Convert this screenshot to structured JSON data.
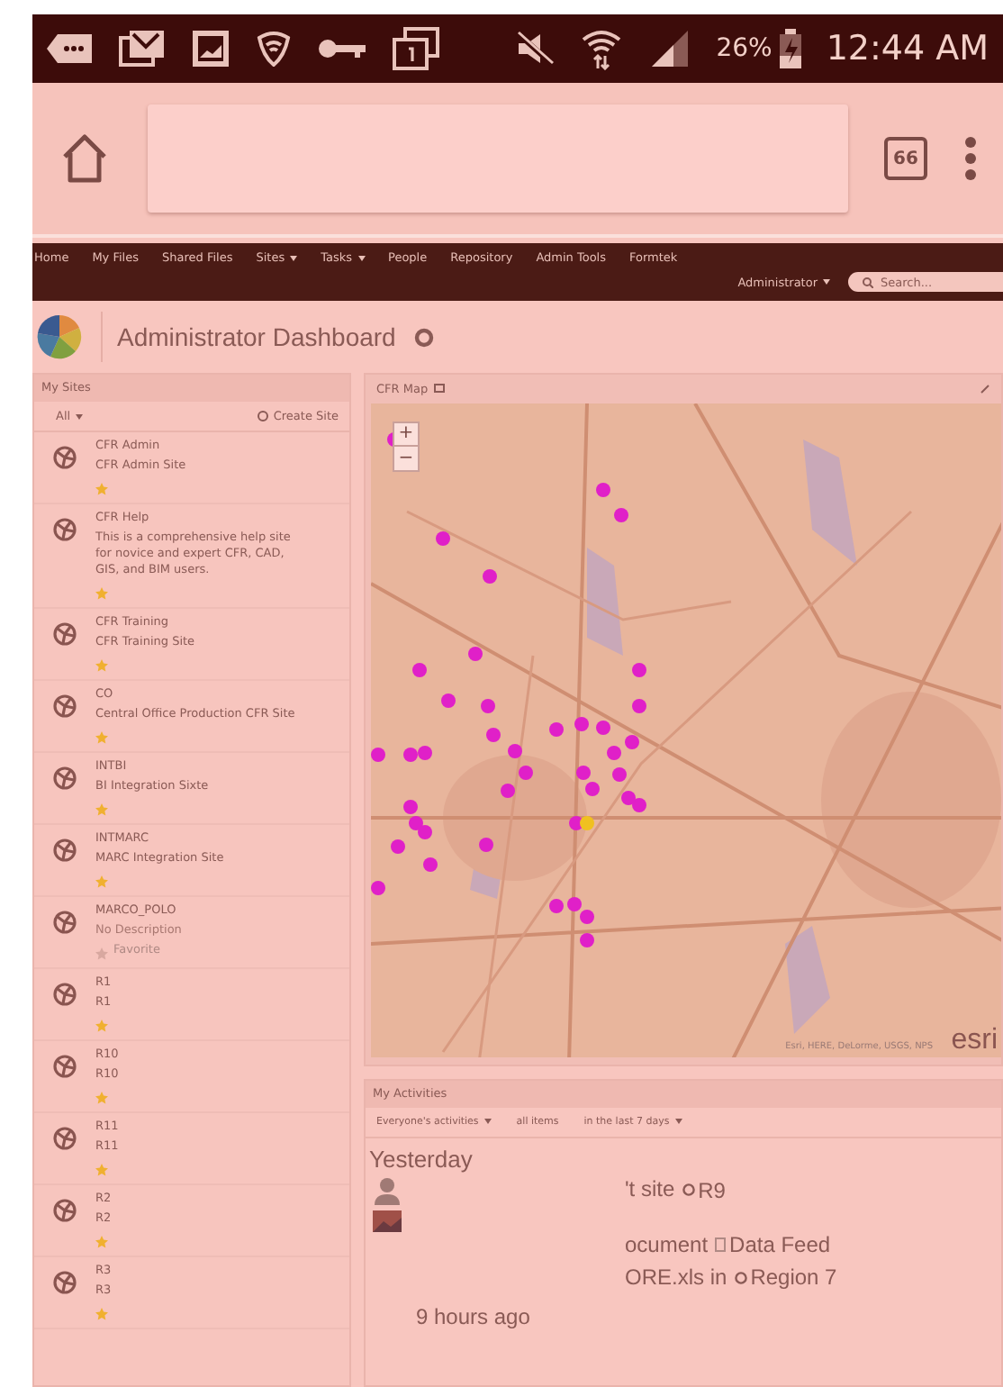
{
  "status_bar": {
    "battery": "26%",
    "time": "12:44 AM"
  },
  "browser": {
    "tab_count": "66"
  },
  "nav": {
    "items": [
      {
        "label": "Home",
        "dropdown": false
      },
      {
        "label": "My Files",
        "dropdown": false
      },
      {
        "label": "Shared Files",
        "dropdown": false
      },
      {
        "label": "Sites",
        "dropdown": true
      },
      {
        "label": "Tasks",
        "dropdown": true
      },
      {
        "label": "People",
        "dropdown": false
      },
      {
        "label": "Repository",
        "dropdown": false
      },
      {
        "label": "Admin Tools",
        "dropdown": false
      },
      {
        "label": "Formtek",
        "dropdown": false
      }
    ],
    "user": "Administrator",
    "search": {
      "placeholder": "Search..."
    }
  },
  "dashboard": {
    "title": "Administrator Dashboard"
  },
  "my_sites": {
    "title": "My Sites",
    "filter": "All",
    "create": "Create Site",
    "sites": [
      {
        "name": "CFR Admin",
        "description": "CFR Admin Site",
        "empty_description": false,
        "favorite": true
      },
      {
        "name": "CFR Help",
        "description": "This is a comprehensive help site for novice and expert CFR, CAD, GIS, and BIM users.",
        "empty_description": false,
        "favorite": true
      },
      {
        "name": "CFR Training",
        "description": "CFR Training Site",
        "empty_description": false,
        "favorite": true
      },
      {
        "name": "CO",
        "description": "Central Office Production CFR Site",
        "empty_description": false,
        "favorite": true
      },
      {
        "name": "INTBI",
        "description": "BI Integration Sixte",
        "empty_description": false,
        "favorite": true
      },
      {
        "name": "INTMARC",
        "description": "MARC Integration Site",
        "empty_description": false,
        "favorite": true
      },
      {
        "name": "MARCO_POLO",
        "description": "No Description",
        "empty_description": true,
        "favorite": false,
        "favorite_label": "Favorite"
      },
      {
        "name": "R1",
        "description": "R1",
        "empty_description": false,
        "favorite": true
      },
      {
        "name": "R10",
        "description": "R10",
        "empty_description": false,
        "favorite": true
      },
      {
        "name": "R11",
        "description": "R11",
        "empty_description": false,
        "favorite": true
      },
      {
        "name": "R2",
        "description": "R2",
        "empty_description": false,
        "favorite": true
      },
      {
        "name": "R3",
        "description": "R3",
        "empty_description": false,
        "favorite": true
      }
    ]
  },
  "map": {
    "title": "CFR Map",
    "zoom_in": "+",
    "zoom_out": "−",
    "attribution": "Esri, HERE, DeLorme, USGS, NPS",
    "logo": "esri"
  },
  "activities": {
    "title": "My Activities",
    "filters": [
      {
        "label": "Everyone's activities",
        "dropdown": true
      },
      {
        "label": "all items",
        "dropdown": false
      },
      {
        "label": "in the last 7 days",
        "dropdown": true
      }
    ],
    "heading": "Yesterday",
    "items": [
      {
        "kind": "user",
        "lines": [
          [
            {
              "kind": "text",
              "text": "'t site"
            },
            {
              "kind": "site",
              "text": "R9"
            }
          ]
        ]
      },
      {
        "kind": "thumbnail",
        "lines": [
          [
            {
              "kind": "text",
              "text": "ocument"
            },
            {
              "kind": "document",
              "text": "Data Feed"
            }
          ],
          [
            {
              "kind": "text",
              "text": "ORE.xls in"
            },
            {
              "kind": "site",
              "text": "Region 7"
            }
          ]
        ],
        "time": "9 hours ago"
      }
    ]
  }
}
